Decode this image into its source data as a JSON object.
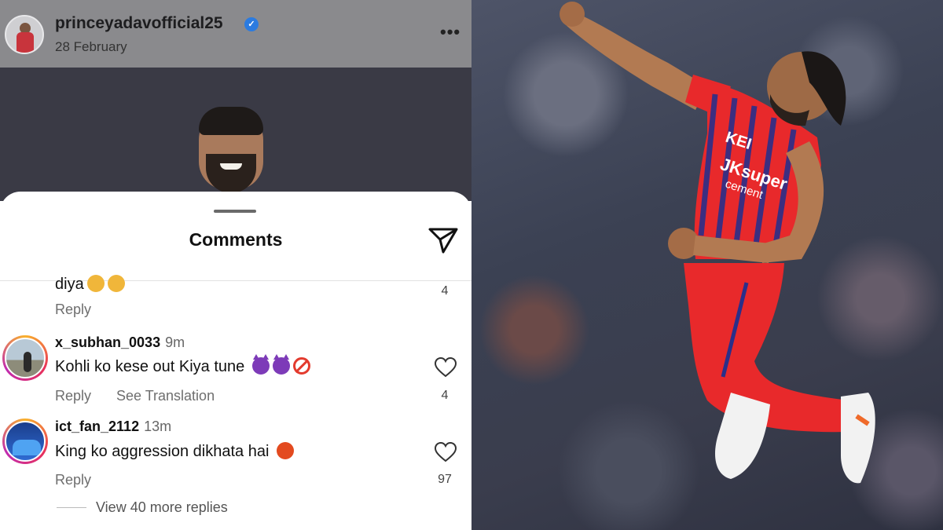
{
  "post": {
    "username": "princeyadavofficial25",
    "date": "28 February",
    "verified_mark": "✓",
    "more": "•••"
  },
  "sheet": {
    "title": "Comments"
  },
  "comments": [
    {
      "text": "diya",
      "reply_label": "Reply",
      "likes": "4"
    },
    {
      "user": "x_subhan_0033",
      "time": "9m",
      "text": "Kohli ko kese out Kiya tune",
      "reply_label": "Reply",
      "translation_label": "See Translation",
      "likes": "4"
    },
    {
      "user": "ict_fan_2112",
      "time": "13m",
      "text": "King ko aggression dikhata hai",
      "reply_label": "Reply",
      "likes": "97"
    }
  ],
  "view_more": "View 40 more replies",
  "jersey": {
    "sponsor_1": "KEI",
    "sponsor_2": "JKsuper",
    "sponsor_3": "cement"
  },
  "colors": {
    "jersey_red": "#e8292b",
    "jersey_blue": "#2a2f8a",
    "ig_ring": "#e8315b"
  }
}
